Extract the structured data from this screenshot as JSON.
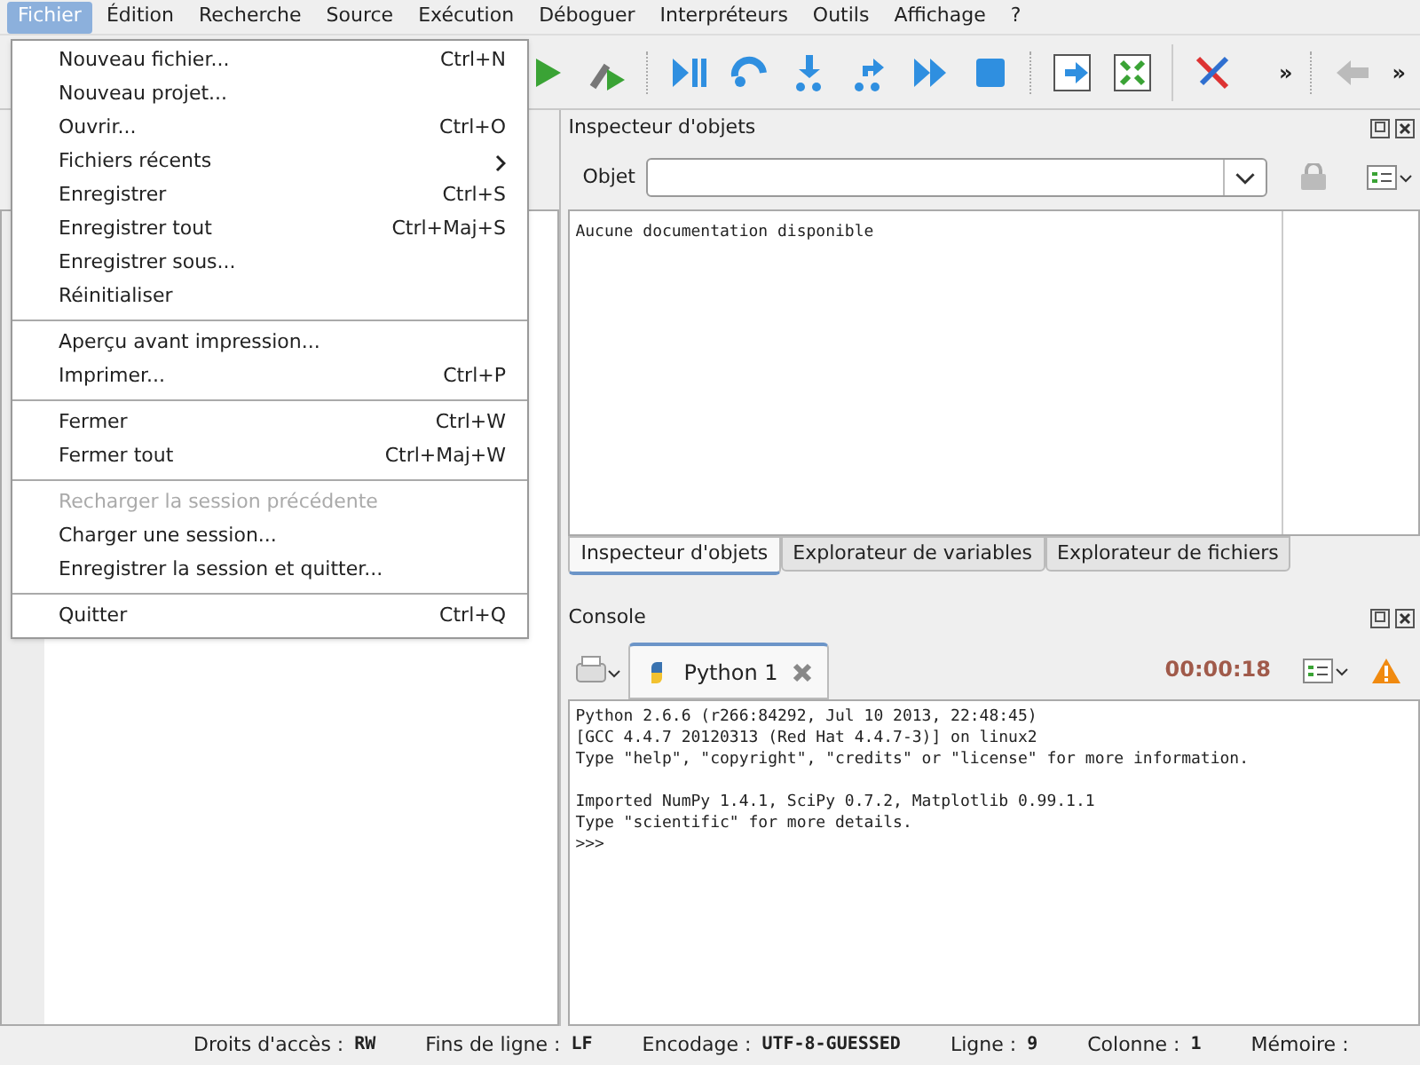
{
  "menubar": [
    {
      "label": "Fichier",
      "selected": true
    },
    {
      "label": "Édition",
      "selected": false
    },
    {
      "label": "Recherche",
      "selected": false
    },
    {
      "label": "Source",
      "selected": false
    },
    {
      "label": "Exécution",
      "selected": false
    },
    {
      "label": "Déboguer",
      "selected": false
    },
    {
      "label": "Interpréteurs",
      "selected": false
    },
    {
      "label": "Outils",
      "selected": false
    },
    {
      "label": "Affichage",
      "selected": false
    },
    {
      "label": "?",
      "selected": false
    }
  ],
  "toolbar": {
    "overflow": [
      "»",
      "»"
    ]
  },
  "file_menu": [
    {
      "kind": "item",
      "label": "Nouveau fichier...",
      "shortcut": "Ctrl+N",
      "disabled": false
    },
    {
      "kind": "item",
      "label": "Nouveau projet...",
      "disabled": false
    },
    {
      "kind": "item",
      "label": "Ouvrir...",
      "shortcut": "Ctrl+O",
      "disabled": false
    },
    {
      "kind": "submenu",
      "label": "Fichiers récents",
      "disabled": false
    },
    {
      "kind": "item",
      "label": "Enregistrer",
      "shortcut": "Ctrl+S",
      "disabled": false
    },
    {
      "kind": "item",
      "label": "Enregistrer tout",
      "shortcut": "Ctrl+Maj+S",
      "disabled": false
    },
    {
      "kind": "item",
      "label": "Enregistrer sous...",
      "disabled": false
    },
    {
      "kind": "item",
      "label": "Réinitialiser",
      "disabled": false
    },
    {
      "kind": "separator"
    },
    {
      "kind": "item",
      "label": "Aperçu avant impression...",
      "disabled": false
    },
    {
      "kind": "item",
      "label": "Imprimer...",
      "shortcut": "Ctrl+P",
      "disabled": false
    },
    {
      "kind": "separator"
    },
    {
      "kind": "item",
      "label": "Fermer",
      "shortcut": "Ctrl+W",
      "disabled": false
    },
    {
      "kind": "item",
      "label": "Fermer tout",
      "shortcut": "Ctrl+Maj+W",
      "disabled": false
    },
    {
      "kind": "separator"
    },
    {
      "kind": "item",
      "label": "Recharger la session précédente",
      "disabled": true
    },
    {
      "kind": "item",
      "label": "Charger une session...",
      "disabled": false
    },
    {
      "kind": "item",
      "label": "Enregistrer la session et quitter...",
      "disabled": false
    },
    {
      "kind": "separator"
    },
    {
      "kind": "item",
      "label": "Quitter",
      "shortcut": "Ctrl+Q",
      "disabled": false
    }
  ],
  "inspector": {
    "title": "Inspecteur d'objets",
    "object_label": "Objet",
    "documentation": "Aucune documentation disponible"
  },
  "right_tabs": [
    {
      "label": "Inspecteur d'objets",
      "selected": true
    },
    {
      "label": "Explorateur de variables",
      "selected": false
    },
    {
      "label": "Explorateur de fichiers",
      "selected": false
    }
  ],
  "console": {
    "title": "Console",
    "tabs": [
      {
        "label": "Python 1",
        "selected": true
      }
    ],
    "timer": "00:00:18",
    "output": [
      [
        "Python 2.6.6 (r266:84292, Jul 10 2013, 22:48:45)",
        "[GCC 4.4.7 20120313 (Red Hat 4.4.7-3)] on linux2",
        "Type \"help\", \"copyright\", \"credits\" or \"license\" for more information."
      ],
      [
        "Imported NumPy 1.4.1, SciPy 0.7.2, Matplotlib 0.99.1.1",
        "Type \"scientific\" for more details.",
        ">>>"
      ]
    ]
  },
  "status_bar": [
    {
      "label": "Droits d'accès :",
      "value": "RW"
    },
    {
      "label": "Fins de ligne :",
      "value": "LF"
    },
    {
      "label": "Encodage :",
      "value": "UTF-8-GUESSED"
    },
    {
      "label": "Ligne :",
      "value": "9"
    },
    {
      "label": "Colonne :",
      "value": "1"
    },
    {
      "label": "Mémoire :"
    }
  ]
}
